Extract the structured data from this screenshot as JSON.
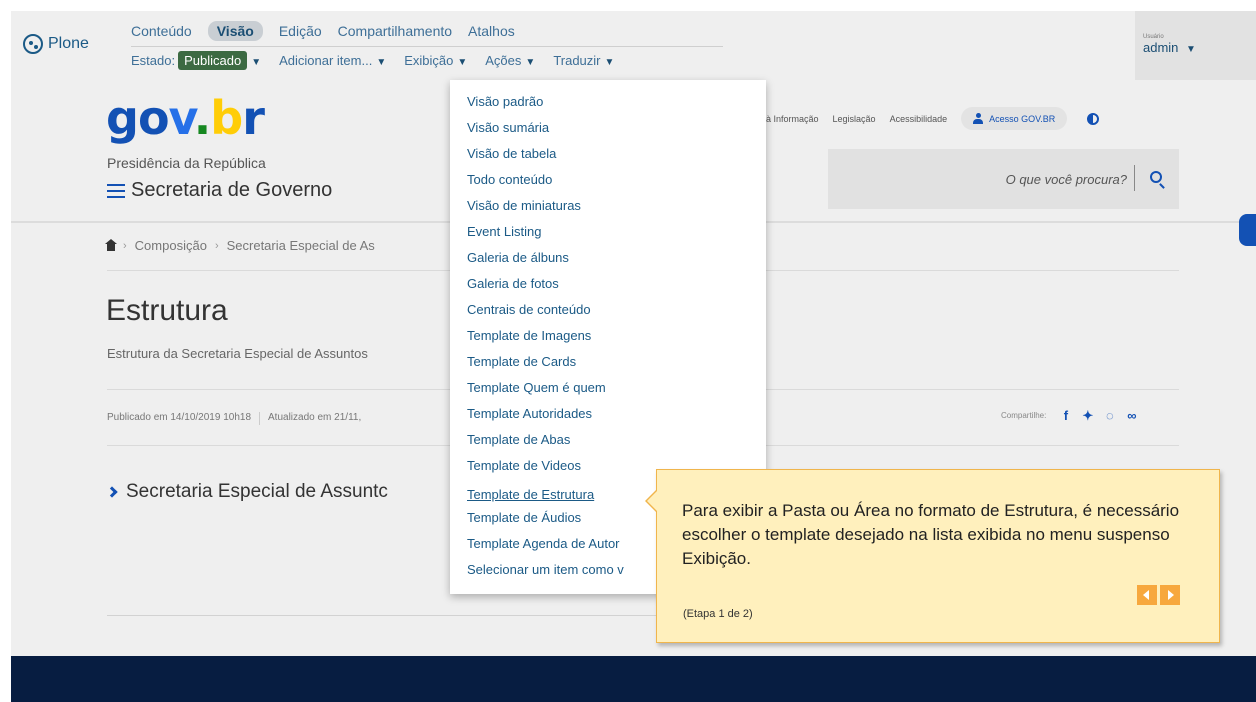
{
  "toolbar": {
    "logo": "Plone",
    "tabs": [
      "Conteúdo",
      "Visão",
      "Edição",
      "Compartilhamento",
      "Atalhos"
    ],
    "state_label": "Estado:",
    "state_value": "Publicado",
    "menus": [
      "Adicionar item...",
      "Exibição",
      "Ações",
      "Traduzir"
    ],
    "user_label": "Usuário",
    "user_name": "admin"
  },
  "site": {
    "presidencia": "Presidência da República",
    "name": "Secretaria de Governo",
    "links": [
      "à Informação",
      "Legislação",
      "Acessibilidade"
    ],
    "login_label": "Acesso GOV.BR",
    "search_placeholder": "O que você procura?"
  },
  "breadcrumb": [
    "Composição",
    "Secretaria Especial de As"
  ],
  "page": {
    "title": "Estrutura",
    "description": "Estrutura da Secretaria Especial de Assuntos",
    "published": "Publicado em 14/10/2019 10h18",
    "updated": "Atualizado em 21/11,",
    "share_label": "Compartilhe:",
    "accordion_title": "Secretaria Especial de Assuntc"
  },
  "display_menu": {
    "items": [
      "Visão padrão",
      "Visão sumária",
      "Visão de tabela",
      "Todo conteúdo",
      "Visão de miniaturas",
      "Event Listing",
      "Galeria de álbuns",
      "Galeria de fotos",
      "Centrais de conteúdo",
      "Template de Imagens",
      "Template de Cards",
      "Template Quem é quem",
      "Template Autoridades",
      "Template de Abas",
      "Template de Videos",
      "Template de Estrutura",
      "Template de Áudios",
      "Template Agenda de Autor",
      "Selecionar um item como v"
    ],
    "highlighted": "Template de Estrutura"
  },
  "tour": {
    "message": "Para exibir a Pasta ou Área no formato de Estrutura, é necessário escolher o template desejado na lista exibida no menu suspenso Exibição.",
    "step": "(Etapa 1 de 2)"
  },
  "colors": {
    "govbr_blue": "#1351b4",
    "tour_bg": "#fff0bd",
    "tour_button": "#f7a83e",
    "footer": "#071d41"
  }
}
